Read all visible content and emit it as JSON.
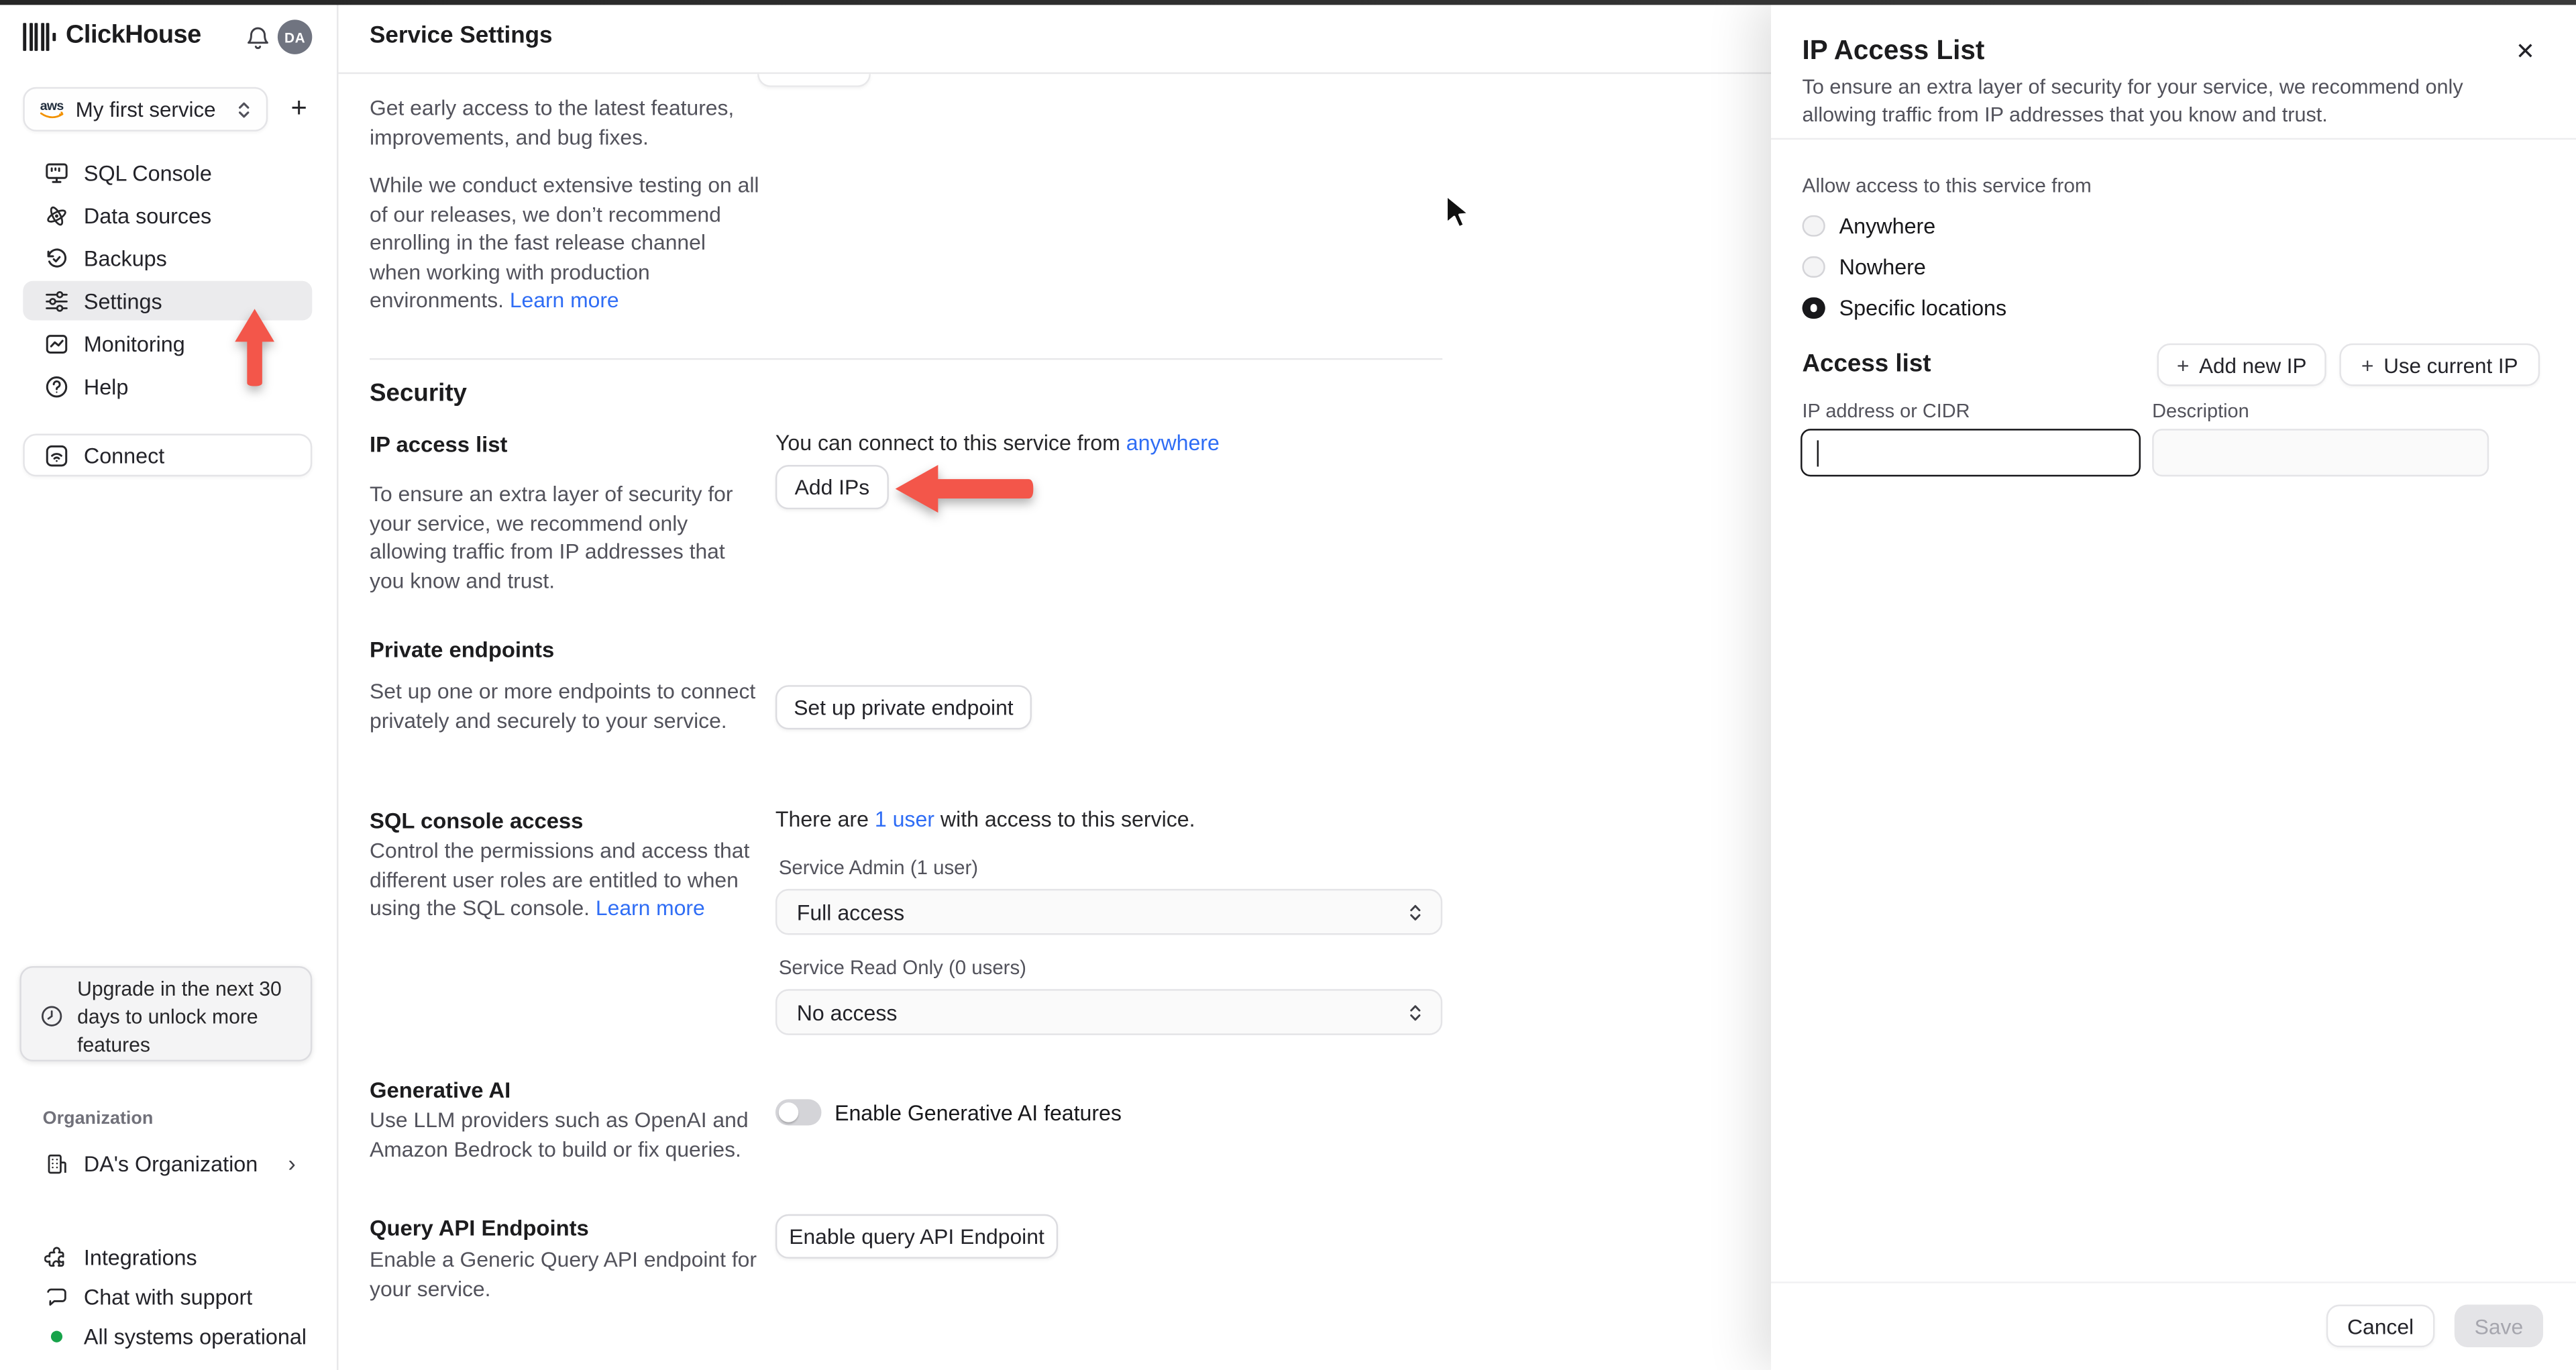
{
  "colors": {
    "link_blue": "#2f6df5",
    "arrow_red": "#f3564a",
    "status_green": "#17a34a",
    "active_item_bg": "#ebebed",
    "save_disabled_bg": "#e4e4e7",
    "save_disabled_text": "#a6a6ae",
    "focused_input_border": "#18181b"
  },
  "icons": {
    "plus": "+",
    "close": "✕",
    "chevron_right": "›"
  },
  "sidebar": {
    "brand": "ClickHouse",
    "avatar_initials": "DA",
    "service_selector_label": "My first service",
    "nav": [
      {
        "label": "SQL Console"
      },
      {
        "label": "Data sources"
      },
      {
        "label": "Backups"
      },
      {
        "label": "Settings"
      },
      {
        "label": "Monitoring"
      },
      {
        "label": "Help"
      }
    ],
    "connect_label": "Connect",
    "upgrade_notice": "Upgrade in the next 30 days to unlock more features",
    "organization_label": "Organization",
    "organization_name": "DA's Organization",
    "footer": [
      {
        "label": "Integrations"
      },
      {
        "label": "Chat with support"
      },
      {
        "label": "All systems operational"
      }
    ]
  },
  "main": {
    "title": "Service Settings",
    "fast_release_para1": "Get early access to the latest features, improvements, and bug fixes.",
    "fast_release_para2": "While we conduct extensive testing on all of our releases, we don’t recommend enrolling in the fast release channel when working with production environments. ",
    "fast_release_learn_more": "Learn more",
    "security_heading": "Security",
    "ip_access": {
      "label": "IP access list",
      "description": "To ensure an extra layer of security for your service, we recommend only allowing traffic from IP addresses that you know and trust.",
      "connect_prefix": "You can connect to this service from ",
      "connect_link": "anywhere",
      "add_ips_button": "Add IPs"
    },
    "private_endpoints": {
      "label": "Private endpoints",
      "description": "Set up one or more endpoints to connect privately and securely to your service.",
      "button": "Set up private endpoint"
    },
    "sql_access": {
      "label": "SQL console access",
      "users_prefix": "There are ",
      "users_link": "1 user",
      "users_suffix": " with access to this service.",
      "description": "Control the permissions and access that different user roles are entitled to when using the SQL console. ",
      "learn_more": "Learn more",
      "admin_label": "Service Admin (1 user)",
      "admin_value": "Full access",
      "readonly_label": "Service Read Only (0 users)",
      "readonly_value": "No access"
    },
    "generative_ai": {
      "label": "Generative AI",
      "description": "Use LLM providers such as OpenAI and Amazon Bedrock to build or fix queries.",
      "toggle_label": "Enable Generative AI features"
    },
    "query_api": {
      "label": "Query API Endpoints",
      "description": "Enable a Generic Query API endpoint for your service.",
      "button": "Enable query API Endpoint"
    }
  },
  "panel": {
    "title": "IP Access List",
    "description": "To ensure an extra layer of security for your service, we recommend only allowing traffic from IP addresses that you know and trust.",
    "allow_label": "Allow access to this service from",
    "radios": [
      {
        "label": "Anywhere",
        "selected": false
      },
      {
        "label": "Nowhere",
        "selected": false
      },
      {
        "label": "Specific locations",
        "selected": true
      }
    ],
    "access_list_heading": "Access list",
    "add_new_ip_button": "Add new IP",
    "use_current_ip_button": "Use current IP",
    "ip_field_label": "IP address or CIDR",
    "ip_field_value": "",
    "description_field_label": "Description",
    "description_field_value": "",
    "cancel_button": "Cancel",
    "save_button": "Save"
  }
}
